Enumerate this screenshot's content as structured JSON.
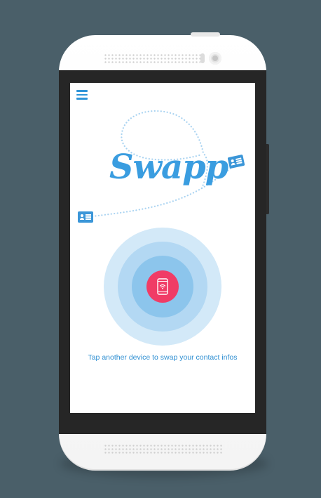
{
  "app": {
    "logo_text": "Swapp",
    "caption": "Tap another device to swap your contact infos"
  },
  "icons": {
    "menu": "hamburger-menu-icon",
    "tap_button": "phone-nfc-icon",
    "card_left": "contact-card-icon",
    "card_right": "contact-card-icon"
  },
  "colors": {
    "background": "#4a5f69",
    "accent_blue": "#3a9de0",
    "tap_button": "#f03c66",
    "ring_outer": "#d3e9f8",
    "ring_middle": "#b3d8f3",
    "ring_inner": "#8cc5ec"
  }
}
